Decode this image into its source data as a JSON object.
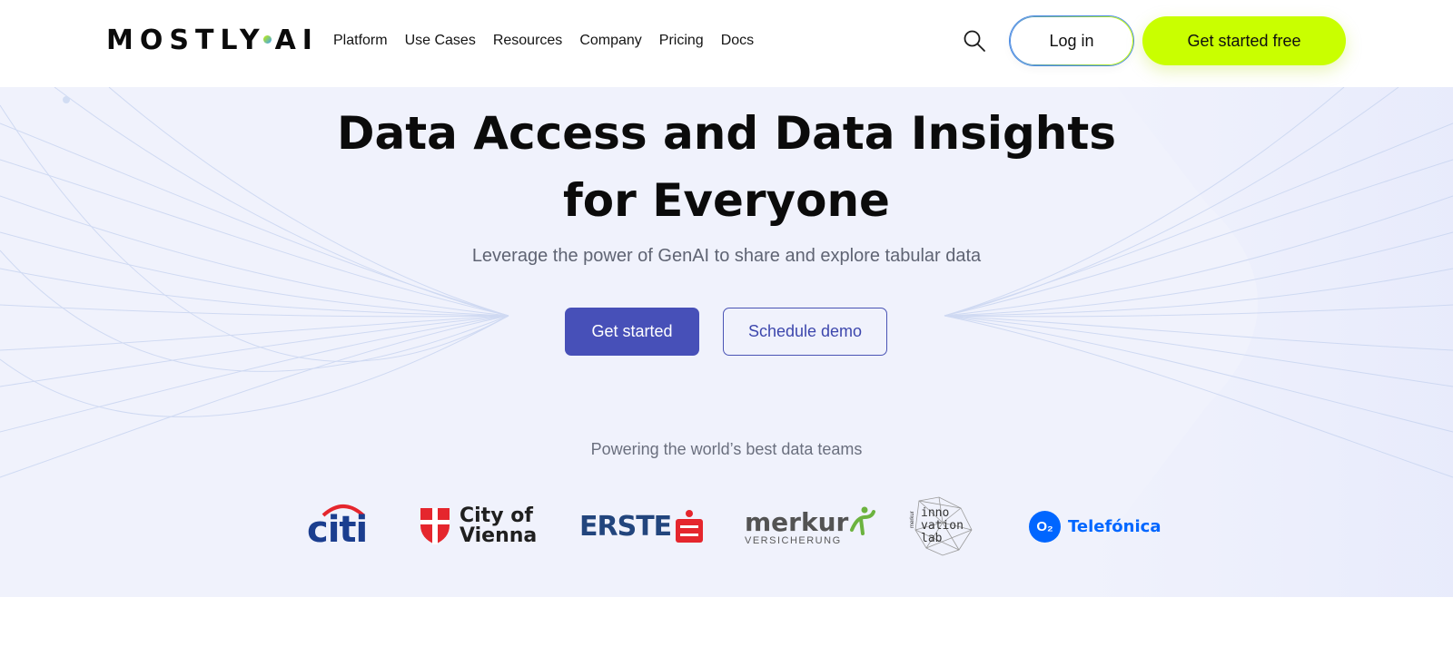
{
  "brand": {
    "logo_left": "MOSTLY",
    "logo_right": "AI"
  },
  "nav": {
    "items": [
      "Platform",
      "Use Cases",
      "Resources",
      "Company",
      "Pricing",
      "Docs"
    ]
  },
  "header": {
    "search_icon": "search-icon",
    "login_label": "Log in",
    "cta_label": "Get started free"
  },
  "hero": {
    "title_line1": "Data Access and Data Insights",
    "title_line2": "for Everyone",
    "subtitle": "Leverage the power of GenAI to share and explore tabular data",
    "primary_button": "Get started",
    "secondary_button": "Schedule demo",
    "powering": "Powering the world’s best data teams"
  },
  "customers": {
    "citi": "citi",
    "vienna_line1": "City of",
    "vienna_line2": "Vienna",
    "erste": "ERSTE",
    "merkur": "merkur",
    "merkur_sub": "VERSICHERUNG",
    "innolab_line1": "inno",
    "innolab_line2": "vation",
    "innolab_line3": "lab",
    "innolab_prefix": "merkur",
    "o2": "O₂",
    "telefonica": "Telefónica"
  },
  "colors": {
    "accent": "#c9ff00",
    "primary": "#4750b8",
    "hero_bg": "#f0f2fc"
  }
}
